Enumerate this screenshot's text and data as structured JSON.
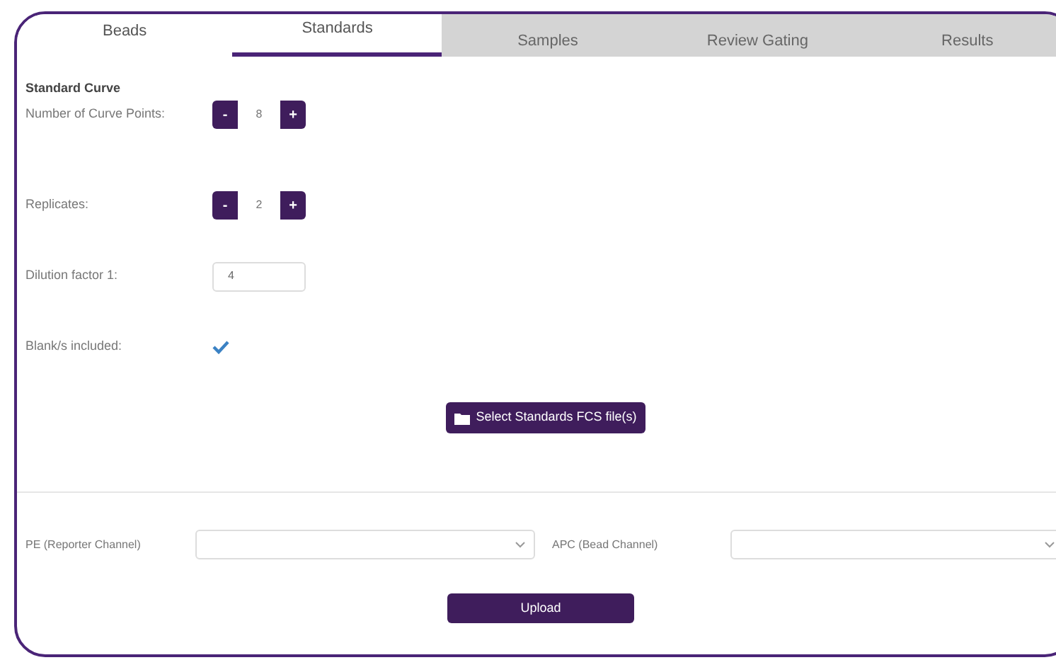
{
  "tabs": [
    {
      "label": "Beads",
      "selected": false,
      "disabled": false
    },
    {
      "label": "Standards",
      "selected": true,
      "disabled": false
    },
    {
      "label": "Samples",
      "selected": false,
      "disabled": true
    },
    {
      "label": "Review Gating",
      "selected": false,
      "disabled": true
    },
    {
      "label": "Results",
      "selected": false,
      "disabled": true
    }
  ],
  "section_title": "Standard Curve",
  "fields": [
    {
      "kind": "stepper",
      "label": "Number of Curve Points:",
      "minus": "-",
      "value": "8",
      "plus": "+"
    },
    {
      "kind": "stepper",
      "label": "Replicates:",
      "minus": "-",
      "value": "2",
      "plus": "+"
    },
    {
      "kind": "text",
      "label": "Dilution factor 1:",
      "value": "4"
    },
    {
      "kind": "checkbox",
      "label": "Blank/s included:",
      "checked": true
    }
  ],
  "select_files_button": "Select Standards FCS file(s)",
  "channels": [
    {
      "label": "PE (Reporter Channel)"
    },
    {
      "label": "APC (Bead Channel)"
    }
  ],
  "upload_button": "Upload"
}
